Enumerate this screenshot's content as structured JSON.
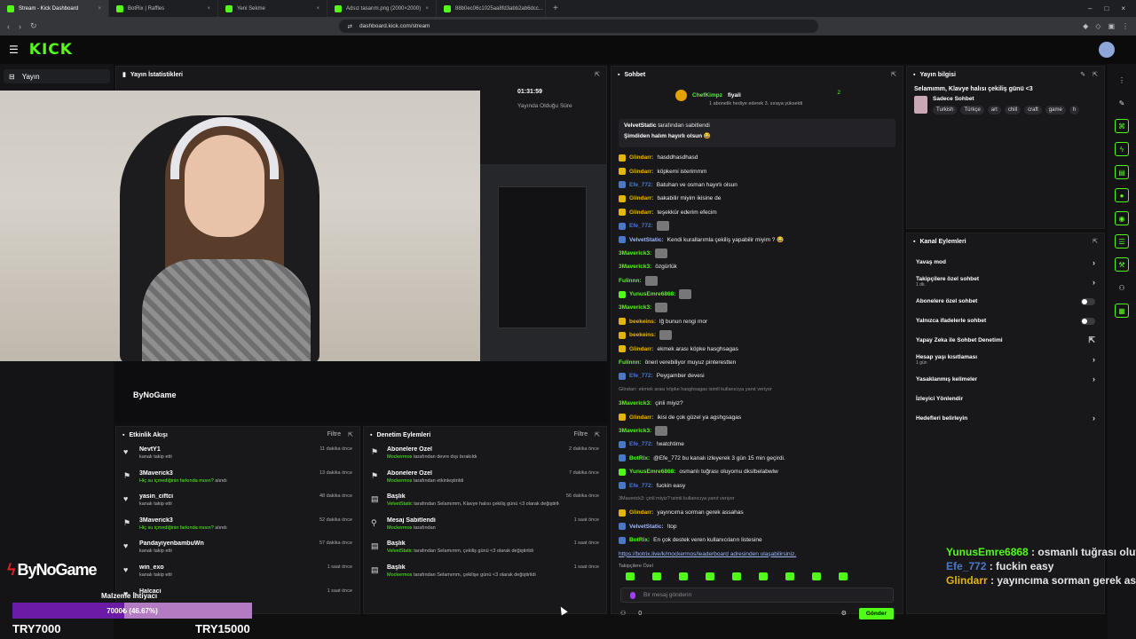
{
  "browser": {
    "tabs": [
      {
        "title": "Stream - Kick Dashboard",
        "active": true
      },
      {
        "title": "BotRix | Raffles",
        "active": false
      },
      {
        "title": "Yeni Sekme",
        "active": false
      },
      {
        "title": "Adsız tasarım.png (2000×2000)",
        "active": false
      },
      {
        "title": "88b0ec06c1025aa8fd3abb2ab6dcc...",
        "active": false
      }
    ],
    "url": "dashboard.kick.com/stream"
  },
  "header": {
    "logo": "KICK"
  },
  "sidenav": {
    "item": "Yayın"
  },
  "stats": {
    "title": "Yayın İstatistikleri",
    "duration": "01:31:59",
    "duration_label": "Yayında Olduğu Süre"
  },
  "activity": {
    "title": "Etkinlik Akışı",
    "filter": "Filtre",
    "rows": [
      {
        "icon": "heart-icon",
        "name": "NevtY1",
        "sub": "kanalı takip etti",
        "sub_hl": "",
        "sub_after": "",
        "time": "11 dakika önce"
      },
      {
        "icon": "gift-icon",
        "name": "3Maverick3",
        "sub": "",
        "sub_hl": "Hiç su içmediğinin farkında mısın?",
        "sub_after": " alındı",
        "time": "13 dakika önce"
      },
      {
        "icon": "heart-icon",
        "name": "yasin_ciftci",
        "sub": "kanalı takip etti",
        "sub_hl": "",
        "sub_after": "",
        "time": "48 dakika önce"
      },
      {
        "icon": "gift-icon",
        "name": "3Maverick3",
        "sub": "",
        "sub_hl": "Hiç su içmediğinin farkında mısın?",
        "sub_after": " alındı",
        "time": "52 dakika önce"
      },
      {
        "icon": "heart-icon",
        "name": "PandayiyenbambuWn",
        "sub": "kanalı takip etti",
        "sub_hl": "",
        "sub_after": "",
        "time": "57 dakika önce"
      },
      {
        "icon": "heart-icon",
        "name": "win_exo",
        "sub": "kanalı takip etti",
        "sub_hl": "",
        "sub_after": "",
        "time": "1 saat önce"
      },
      {
        "icon": "heart-icon",
        "name": "Halcaci",
        "sub": "",
        "sub_hl": "",
        "sub_after": "",
        "time": "1 saat önce"
      }
    ]
  },
  "moderation": {
    "title": "Denetim Eylemleri",
    "filter": "Filtre",
    "rows": [
      {
        "icon": "gift-icon",
        "name": "Abonelere Özel",
        "user": "Mockermos",
        "text": " tarafından devre dışı bırakıldı",
        "time": "2 dakika önce"
      },
      {
        "icon": "gift-icon",
        "name": "Abonelere Özel",
        "user": "Mockermos",
        "text": " tarafından etkinleştirildi",
        "time": "7 dakika önce"
      },
      {
        "icon": "text-icon",
        "name": "Başlık",
        "user": "VelvetStatic",
        "text": " tarafından Selamımm, Klavye halısı çekiliş günü <3 olarak değiştirildi",
        "time": "56 dakika önce"
      },
      {
        "icon": "pin-icon",
        "name": "Mesaj Sabitlendi",
        "user": "Mockermos",
        "text": " tarafından",
        "time": "1 saat önce"
      },
      {
        "icon": "text-icon",
        "name": "Başlık",
        "user": "VelvetStatic",
        "text": " tarafından Selamımm, çekiliş günü <3 olarak değiştirildi",
        "time": "1 saat önce"
      },
      {
        "icon": "text-icon",
        "name": "Başlık",
        "user": "Mockermos",
        "text": " tarafından Selamımm, çekilişe günü <3 olarak değiştirildi",
        "time": "1 saat önce"
      }
    ]
  },
  "chat": {
    "title": "Sohbet",
    "gifter": "ChefKimpz",
    "gifter_target": "fiyali",
    "gift_info": "1 abonelik hediye ederek 3. sıraya yükseldi",
    "gift_count": "2",
    "pinned_user": "VelvetStatic",
    "pinned_by": "tarafından sabitlendi",
    "pinned_msg": "Şimdiden halım hayırlı olsun 😂",
    "messages": [
      {
        "user": "Glindarr",
        "color": "#e5b500",
        "text": "hasddhasdhasd",
        "badge": "b-yellow"
      },
      {
        "user": "Glindarr",
        "color": "#e5b500",
        "text": "köpkemi isterimmm",
        "badge": "b-yellow"
      },
      {
        "user": "Efe_772",
        "color": "#4a78c9",
        "text": "Batuhan ve osman hayırlı olsun",
        "badge": "b-blue"
      },
      {
        "user": "Glindarr",
        "color": "#e5b500",
        "text": "bakabilir miyim ikisine de",
        "badge": "b-yellow"
      },
      {
        "user": "Glindarr",
        "color": "#e5b500",
        "text": "teşekkür ederim efecim",
        "badge": "b-yellow"
      },
      {
        "user": "Efe_772",
        "color": "#4a78c9",
        "text": "",
        "badge": "b-blue"
      },
      {
        "user": "VelvetStatic",
        "color": "#9fb9ff",
        "text": "Kendi kurallarımla çekiliş yapabilir miyim ? 😂",
        "badge": "b-blue"
      },
      {
        "user": "3Maverick3",
        "color": "#53fc18",
        "text": "",
        "badge": ""
      },
      {
        "user": "3Maverick3",
        "color": "#53fc18",
        "text": "özgürlük",
        "badge": ""
      },
      {
        "user": "Fulinnn",
        "color": "#53fc18",
        "text": "",
        "badge": ""
      },
      {
        "user": "YunusEmre6868",
        "color": "#53fc18",
        "text": "",
        "badge": "b-green"
      },
      {
        "user": "3Maverick3",
        "color": "#53fc18",
        "text": "",
        "badge": ""
      },
      {
        "user": "beekeins",
        "color": "#e5b500",
        "text": "lğ bunun rengi mor",
        "badge": "b-yellow"
      },
      {
        "user": "beekeins",
        "color": "#e5b500",
        "text": "",
        "badge": "b-yellow"
      },
      {
        "user": "Glindarr",
        "color": "#e5b500",
        "text": "ekmek arası köpke hasghsagas",
        "badge": "b-yellow"
      },
      {
        "user": "Fulinnn",
        "color": "#53fc18",
        "text": "öneri verebiliyor muyuz pinterestten",
        "badge": ""
      },
      {
        "user": "Efe_772",
        "color": "#4a78c9",
        "text": "Peygamber devesi",
        "badge": "b-blue"
      },
      {
        "user": "",
        "color": "#888",
        "text": "Glindarr: ekmek arası köpke hasghsagas isimli kullanıcıya yanıt veriyor",
        "badge": "sys"
      },
      {
        "user": "3Maverick3",
        "color": "#53fc18",
        "text": "çinli miyiz?",
        "badge": ""
      },
      {
        "user": "Glindarr",
        "color": "#e5b500",
        "text": "ikisi de çok güzel ya agshgsagas",
        "badge": "b-yellow"
      },
      {
        "user": "3Maverick3",
        "color": "#53fc18",
        "text": "",
        "badge": ""
      },
      {
        "user": "Efe_772",
        "color": "#4a78c9",
        "text": "!watchtime",
        "badge": "b-blue"
      },
      {
        "user": "BotRix",
        "color": "#53fc18",
        "text": "@Efe_772 bu kanalı izleyerek 3 gün 15 min geçirdi.",
        "badge": "b-blue"
      },
      {
        "user": "YunusEmre6868",
        "color": "#53fc18",
        "text": "osmanlı tuğrası oluyomu dksIbelabwlw",
        "badge": "b-green"
      },
      {
        "user": "Efe_772",
        "color": "#4a78c9",
        "text": "fuckin easy",
        "badge": "b-blue"
      },
      {
        "user": "",
        "color": "#888",
        "text": "3Maverick3: çinli miyiz? isimli kullanıcıya yanıt veriyor",
        "badge": "sys"
      },
      {
        "user": "Glindarr",
        "color": "#e5b500",
        "text": "yayıncıma sorman gerek assahas",
        "badge": "b-yellow"
      },
      {
        "user": "VelvetStatic",
        "color": "#9fb9ff",
        "text": "!top",
        "badge": "b-blue"
      },
      {
        "user": "BotRix",
        "color": "#53fc18",
        "text": "En çok destek veren kullanıcıların listesine",
        "badge": "b-blue"
      },
      {
        "user": "",
        "color": "#9fb9ff",
        "text": "https://botrix.live/k/mockermos/leaderboard adresinden ulaşabilirsiniz.",
        "badge": "link"
      }
    ],
    "followers_label": "Takipçilere Özel",
    "input_placeholder": "Bir mesaj gönderin",
    "count": "0",
    "send": "Gönder"
  },
  "info": {
    "title": "Yayın bilgisi",
    "stream_title": "Selamımm, Klavye halısı çekiliş günü <3",
    "category": "Sadece Sohbet",
    "tags": [
      "Turkish",
      "Türkçe",
      "art",
      "chill",
      "craft",
      "game",
      "h"
    ]
  },
  "channel_actions": {
    "title": "Kanal Eylemleri",
    "rows": [
      {
        "label": "Yavaş mod",
        "sub": "",
        "ctl": "chevron"
      },
      {
        "label": "Takipçilere özel sohbet",
        "sub": "1 dk.",
        "ctl": "chevron"
      },
      {
        "label": "Abonelere özel sohbet",
        "sub": "",
        "ctl": "toggle"
      },
      {
        "label": "Yalnızca ifadelerle sohbet",
        "sub": "",
        "ctl": "toggle"
      },
      {
        "label": "Yapay Zeka ile Sohbet Denetimi",
        "sub": "",
        "ctl": "ext"
      },
      {
        "label": "Hesap yaşı kısıtlaması",
        "sub": "1 gün",
        "ctl": "chevron"
      },
      {
        "label": "Yasaklanmış kelimeler",
        "sub": "",
        "ctl": "chevron"
      },
      {
        "label": "İzleyici Yönlendir",
        "sub": "",
        "ctl": ""
      },
      {
        "label": "Hedefleri belirleyin",
        "sub": "",
        "ctl": "chevron"
      }
    ]
  },
  "overlay": {
    "logo": "ByNoGame",
    "goal_title": "Malzeme İhtiyacı",
    "goal_text": "7000₺ (46.67%)",
    "goal_progress": 0.4667,
    "goal_min": "TRY7000",
    "goal_max": "TRY15000",
    "chat": [
      {
        "user": "YunusEmre6868",
        "color": "#53fc18",
        "text": " : osmanlı tuğrası oluyomu dksIbelabwlw"
      },
      {
        "user": "Efe_772",
        "color": "#4a78c9",
        "text": " : fuckin easy"
      },
      {
        "user": "Glindarr",
        "color": "#e5b500",
        "text": " : yayıncıma sorman gerek assahas"
      }
    ]
  }
}
